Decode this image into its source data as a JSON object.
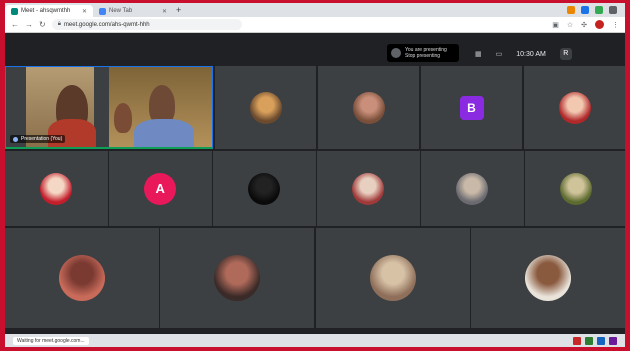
{
  "browser": {
    "tabs": [
      {
        "label": "Meet - ahsqwmthh",
        "active": true
      },
      {
        "label": "New Tab",
        "active": false
      }
    ],
    "new_tab_icon": "plus-icon",
    "url": "meet.google.com/ahs-qwmt-hhh",
    "nav_icons": [
      "back-arrow-icon",
      "forward-arrow-icon",
      "reload-icon"
    ]
  },
  "meet": {
    "presenter_chip": {
      "line1": "You are presenting",
      "line2": "Stop presenting"
    },
    "time": "10:30 AM",
    "self_initial": "R",
    "featured": {
      "name": "Presentation (You)"
    },
    "avatar_tiles": [
      {
        "kind": "photo",
        "colors": [
          "#6b4a2e",
          "#d9a05b"
        ]
      },
      {
        "kind": "photo",
        "colors": [
          "#7a4f3a",
          "#c98f7a"
        ]
      },
      {
        "kind": "letter",
        "letter": "B",
        "bg": "#8a2be2"
      },
      {
        "kind": "photo",
        "colors": [
          "#b0282a",
          "#f2c8b0"
        ]
      },
      {
        "kind": "photo",
        "colors": [
          "#c41e2c",
          "#f4d7c4"
        ]
      },
      {
        "kind": "letter",
        "letter": "A",
        "bg": "#e8185a"
      },
      {
        "kind": "photo",
        "colors": [
          "#0a0a0a",
          "#222"
        ]
      },
      {
        "kind": "photo",
        "colors": [
          "#a03a3a",
          "#e8d0c0"
        ]
      },
      {
        "kind": "photo",
        "colors": [
          "#6a6a70",
          "#c9b9a8"
        ]
      },
      {
        "kind": "photo",
        "colors": [
          "#5d6b2f",
          "#cfc39a"
        ]
      },
      {
        "kind": "photo",
        "colors": [
          "#c96b5a",
          "#7a3a32"
        ]
      },
      {
        "kind": "photo",
        "colors": [
          "#3a2a28",
          "#b06a5a"
        ]
      },
      {
        "kind": "photo",
        "colors": [
          "#8f6f5a",
          "#d7c2a6"
        ]
      },
      {
        "kind": "photo",
        "colors": [
          "#e9e3da",
          "#8a5a3f"
        ]
      }
    ]
  },
  "status": {
    "text": "Waiting for meet.google.com..."
  },
  "colors": {
    "frame": "#c8102e",
    "meet_bg": "#202124",
    "tile": "#3c4043",
    "accent": "#1a73e8"
  }
}
